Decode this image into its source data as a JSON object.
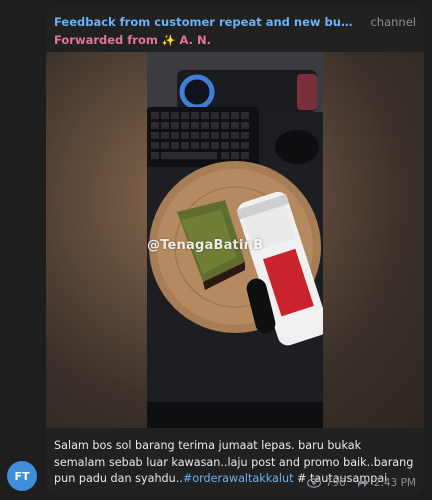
{
  "post": {
    "title": "Feedback from customer repeat and new buuyer #thai...",
    "badge": "channel",
    "forwarded_prefix": "Forwarded from",
    "forwarded_name": "A. N.",
    "watermark": "@TenagaBatinB",
    "caption_text": "Salam bos sol barang terima jumaat lepas. baru bukak semalam sebab luar kawasan..laju post and promo baik..barang pun padu dan syahdu..",
    "caption_tag": "#orderawaltakkalut",
    "caption_tail": " # tautausampai",
    "views": "796",
    "time": "2:43 PM"
  },
  "avatar": {
    "initials": "FT",
    "color": "#3f8fd8"
  },
  "colors": {
    "link": "#6bb2f2",
    "forward": "#e5739a",
    "meta": "#8a8f96",
    "bubble": "#212121"
  },
  "icons": [
    "forward-sparkle-icon",
    "eye-icon",
    "share-icon"
  ]
}
